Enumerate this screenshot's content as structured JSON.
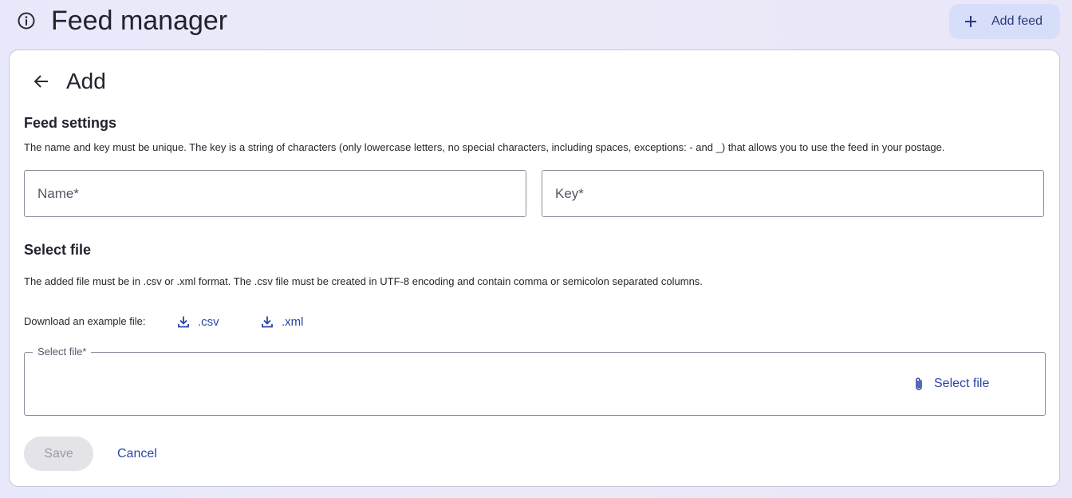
{
  "header": {
    "info_icon": "info-circle-icon",
    "title": "Feed manager",
    "add_button_icon": "plus-icon",
    "add_button_label": "Add feed"
  },
  "card": {
    "back_icon": "arrow-left-icon",
    "title": "Add"
  },
  "feed_settings": {
    "title": "Feed settings",
    "description": "The name and key must be unique. The key is a string of characters (only lowercase letters, no special characters, including spaces, exceptions: - and _) that allows you to use the feed in your postage.",
    "name_placeholder": "Name*",
    "name_value": "",
    "key_placeholder": "Key*",
    "key_value": ""
  },
  "select_file": {
    "title": "Select file",
    "description": "The added file must be in .csv or .xml format. The .csv file must be created in UTF-8 encoding and contain comma or semicolon separated columns.",
    "download_label": "Download an example file:",
    "download_icon": "download-icon",
    "downloads": [
      ".csv",
      ".xml"
    ],
    "file_field_label": "Select file*",
    "file_button_icon": "paperclip-icon",
    "file_button_label": "Select file"
  },
  "actions": {
    "save_label": "Save",
    "cancel_label": "Cancel"
  },
  "colors": {
    "accent": "#2b44a5",
    "add_button_bg": "#d6defa",
    "disabled_bg": "#e3e3e8"
  }
}
